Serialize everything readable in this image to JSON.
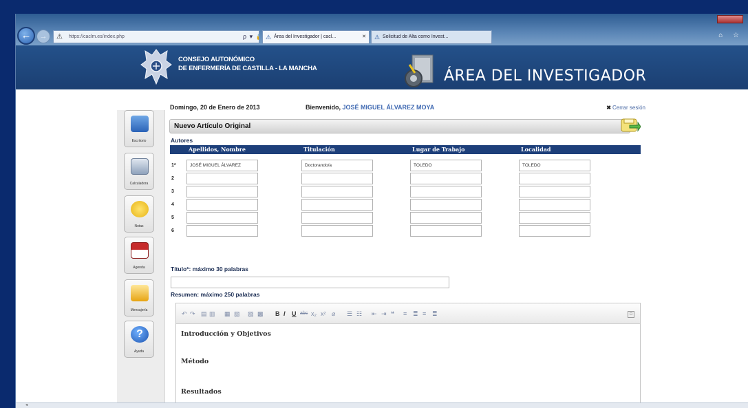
{
  "browser": {
    "address": "https://caclm.es/index.php",
    "address_tools": "ρ ▾ 🔒 ☐ ⟳ ✕",
    "tabs": [
      {
        "label": "Área del Investigador | cacl...",
        "close": "✕"
      },
      {
        "label": "Solicitud de Alta como Invest..."
      }
    ],
    "nav_icons": "⌂ ☆"
  },
  "banner": {
    "org_line1": "CONSEJO AUTONÓMICO",
    "org_line2": "DE ENFERMERÍA DE CASTILLA - LA MANCHA",
    "area_title": "ÁREA DEL INVESTIGADOR"
  },
  "header": {
    "date": "Domingo, 20 de Enero de 2013",
    "welcome_prefix": "Bienvenido, ",
    "user_name": "JOSÉ MIGUEL ÁLVAREZ MOYA",
    "logout_icon": "✖",
    "logout": "Cerrar sesión"
  },
  "sidebar": {
    "items": [
      {
        "label": "Escritorio",
        "icon": "desktop-icon"
      },
      {
        "label": "Calculadora",
        "icon": "calculator-icon"
      },
      {
        "label": "Notas",
        "icon": "notes-icon"
      },
      {
        "label": "Agenda",
        "icon": "calendar-icon"
      },
      {
        "label": "Mensajería",
        "icon": "messages-icon"
      },
      {
        "label": "Ayuda",
        "icon": "help-icon"
      }
    ]
  },
  "form": {
    "title": "Nuevo Artículo Original",
    "authors_label": "Autores",
    "columns": [
      "Apellidos, Nombre",
      "Titulación",
      "Lugar de Trabajo",
      "Localidad"
    ],
    "rows": [
      {
        "num": "1*",
        "name": "JOSÉ MIGUEL ÁLVAREZ",
        "degree": "Doctorando/a",
        "workplace": "TOLEDO",
        "city": "TOLEDO"
      },
      {
        "num": "2",
        "name": "",
        "degree": "",
        "workplace": "",
        "city": ""
      },
      {
        "num": "3",
        "name": "",
        "degree": "",
        "workplace": "",
        "city": ""
      },
      {
        "num": "4",
        "name": "",
        "degree": "",
        "workplace": "",
        "city": ""
      },
      {
        "num": "5",
        "name": "",
        "degree": "",
        "workplace": "",
        "city": ""
      },
      {
        "num": "6",
        "name": "",
        "degree": "",
        "workplace": "",
        "city": ""
      }
    ],
    "title_label": "Título*:  máximo 30 palabras",
    "title_value": "",
    "summary_label": "Resumen:    máximo 250 palabras",
    "editor": {
      "toolbar": [
        "↶",
        "↷",
        "▤",
        "▥",
        "▦",
        "▧",
        "▨",
        "▩",
        "B",
        "I",
        "U",
        "abc",
        "x₂",
        "x²",
        "⌀",
        "☰",
        "☷",
        "⇤",
        "⇥",
        "❝",
        "≡",
        "≣",
        "≡",
        "≣"
      ],
      "maximize": "□",
      "headings": [
        "Introducción y Objetivos",
        "Método",
        "Resultados"
      ]
    }
  }
}
